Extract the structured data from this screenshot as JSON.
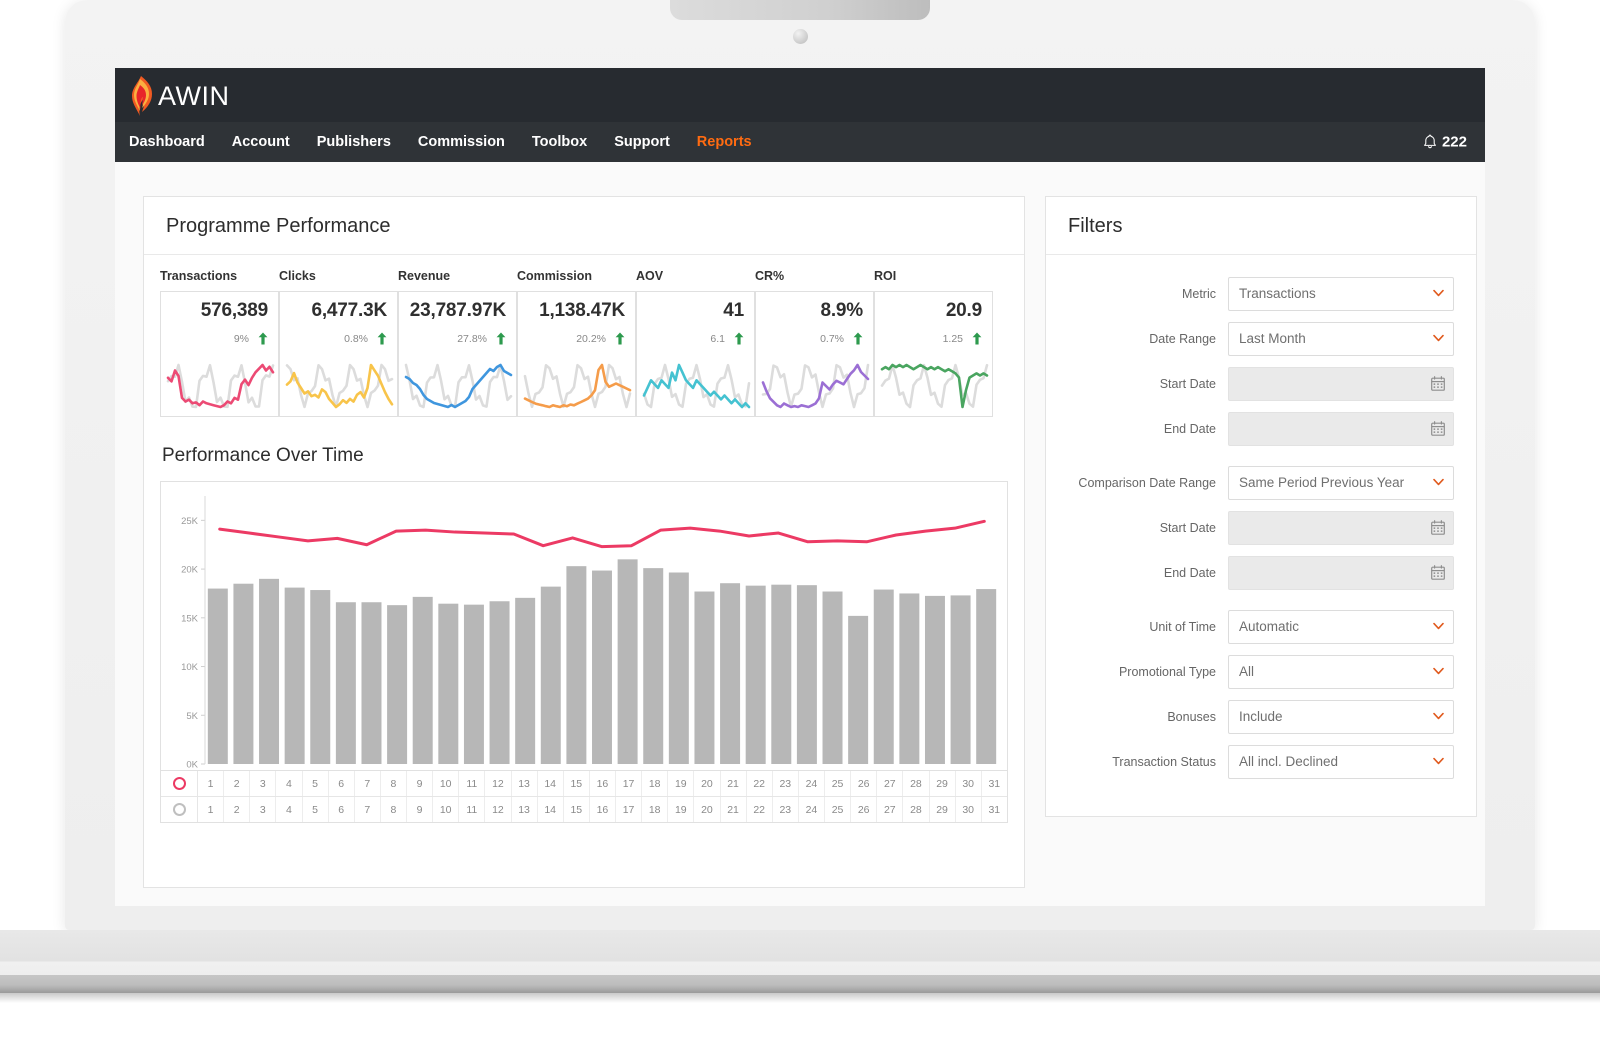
{
  "brand": {
    "name": "AWIN",
    "logo_icon": "flame-icon"
  },
  "nav": {
    "items": [
      {
        "label": "Dashboard",
        "active": false
      },
      {
        "label": "Account",
        "active": false
      },
      {
        "label": "Publishers",
        "active": false
      },
      {
        "label": "Commission",
        "active": false
      },
      {
        "label": "Toolbox",
        "active": false
      },
      {
        "label": "Support",
        "active": false
      },
      {
        "label": "Reports",
        "active": true
      }
    ],
    "active_color": "#ff6b11",
    "notifications": {
      "icon": "bell-icon",
      "count": "222"
    }
  },
  "performance_card": {
    "title": "Programme Performance",
    "kpis": [
      {
        "label": "Transactions",
        "value": "576,389",
        "delta": "9%",
        "trend": "up",
        "color": "#ec4a74"
      },
      {
        "label": "Clicks",
        "value": "6,477.3K",
        "delta": "0.8%",
        "trend": "up",
        "color": "#f8c44a"
      },
      {
        "label": "Revenue",
        "value": "23,787.97K",
        "delta": "27.8%",
        "trend": "up",
        "color": "#3f96de"
      },
      {
        "label": "Commission",
        "value": "1,138.47K",
        "delta": "20.2%",
        "trend": "up",
        "color": "#f59c4a"
      },
      {
        "label": "AOV",
        "value": "41",
        "delta": "6.1",
        "trend": "up",
        "color": "#45c2d1"
      },
      {
        "label": "CR%",
        "value": "8.9%",
        "delta": "0.7%",
        "trend": "up",
        "color": "#9b6fd4"
      },
      {
        "label": "ROI",
        "value": "20.9",
        "delta": "1.25",
        "trend": "up",
        "color": "#4aa560"
      }
    ],
    "arrow_color": "#2d9a4e",
    "comparison_color": "#dcdcdc",
    "chart_title": "Performance Over Time"
  },
  "chart_data": {
    "type": "bar",
    "title": "Performance Over Time",
    "xlabel": "",
    "ylabel": "",
    "ylim": [
      0,
      27500
    ],
    "grid": false,
    "legend": "bottom",
    "ytick_labels": [
      "0K",
      "5K",
      "10K",
      "15K",
      "20K",
      "25K"
    ],
    "ytick_values": [
      0,
      5000,
      10000,
      15000,
      20000,
      25000
    ],
    "categories": [
      "1",
      "2",
      "3",
      "4",
      "5",
      "6",
      "7",
      "8",
      "9",
      "10",
      "11",
      "12",
      "13",
      "14",
      "15",
      "16",
      "17",
      "18",
      "19",
      "20",
      "21",
      "22",
      "23",
      "24",
      "25",
      "26",
      "27",
      "28",
      "29",
      "30",
      "31"
    ],
    "series": [
      {
        "name": "Current Period",
        "type": "bar",
        "color": "#b7b7b7",
        "values": [
          18000,
          18500,
          19000,
          18100,
          17850,
          16600,
          16600,
          16300,
          17150,
          16450,
          16350,
          16700,
          17050,
          18200,
          20300,
          19850,
          21000,
          20100,
          19650,
          17700,
          18550,
          18300,
          18400,
          18350,
          17700,
          15200,
          17900,
          17500,
          17250,
          17300,
          17950
        ]
      },
      {
        "name": "Comparison Period",
        "type": "line",
        "color": "#ec3a64",
        "values": [
          24100,
          23700,
          23300,
          22900,
          23150,
          22500,
          23900,
          24000,
          23800,
          23700,
          23600,
          22400,
          23200,
          22300,
          22400,
          24000,
          24200,
          23900,
          23400,
          23700,
          22800,
          22900,
          22800,
          23500,
          23900,
          24200,
          24900
        ]
      }
    ],
    "legend_rows": [
      {
        "marker": "circle-outline",
        "color": "#ec3a64",
        "labels": [
          "1",
          "2",
          "3",
          "4",
          "5",
          "6",
          "7",
          "8",
          "9",
          "10",
          "11",
          "12",
          "13",
          "14",
          "15",
          "16",
          "17",
          "18",
          "19",
          "20",
          "21",
          "22",
          "23",
          "24",
          "25",
          "26",
          "27",
          "28",
          "29",
          "30",
          "31"
        ]
      },
      {
        "marker": "circle-outline",
        "color": "#bfbfbf",
        "labels": [
          "1",
          "2",
          "3",
          "4",
          "5",
          "6",
          "7",
          "8",
          "9",
          "10",
          "11",
          "12",
          "13",
          "14",
          "15",
          "16",
          "17",
          "18",
          "19",
          "20",
          "21",
          "22",
          "23",
          "24",
          "25",
          "26",
          "27",
          "28",
          "29",
          "30",
          "31"
        ]
      }
    ]
  },
  "filters": {
    "title": "Filters",
    "rows": [
      {
        "label": "Metric",
        "value": "Transactions",
        "kind": "select"
      },
      {
        "label": "Date Range",
        "value": "Last Month",
        "kind": "select"
      },
      {
        "label": "Start Date",
        "value": "",
        "kind": "date"
      },
      {
        "label": "End Date",
        "value": "",
        "kind": "date"
      },
      {
        "label": "Comparison Date Range",
        "value": "Same Period Previous Year",
        "kind": "select"
      },
      {
        "label": "Start Date",
        "value": "",
        "kind": "date"
      },
      {
        "label": "End Date",
        "value": "",
        "kind": "date"
      },
      {
        "label": "Unit of Time",
        "value": "Automatic",
        "kind": "select"
      },
      {
        "label": "Promotional Type",
        "value": "All",
        "kind": "select"
      },
      {
        "label": "Bonuses",
        "value": "Include",
        "kind": "select"
      },
      {
        "label": "Transaction Status",
        "value": "All incl. Declined",
        "kind": "select"
      }
    ]
  }
}
